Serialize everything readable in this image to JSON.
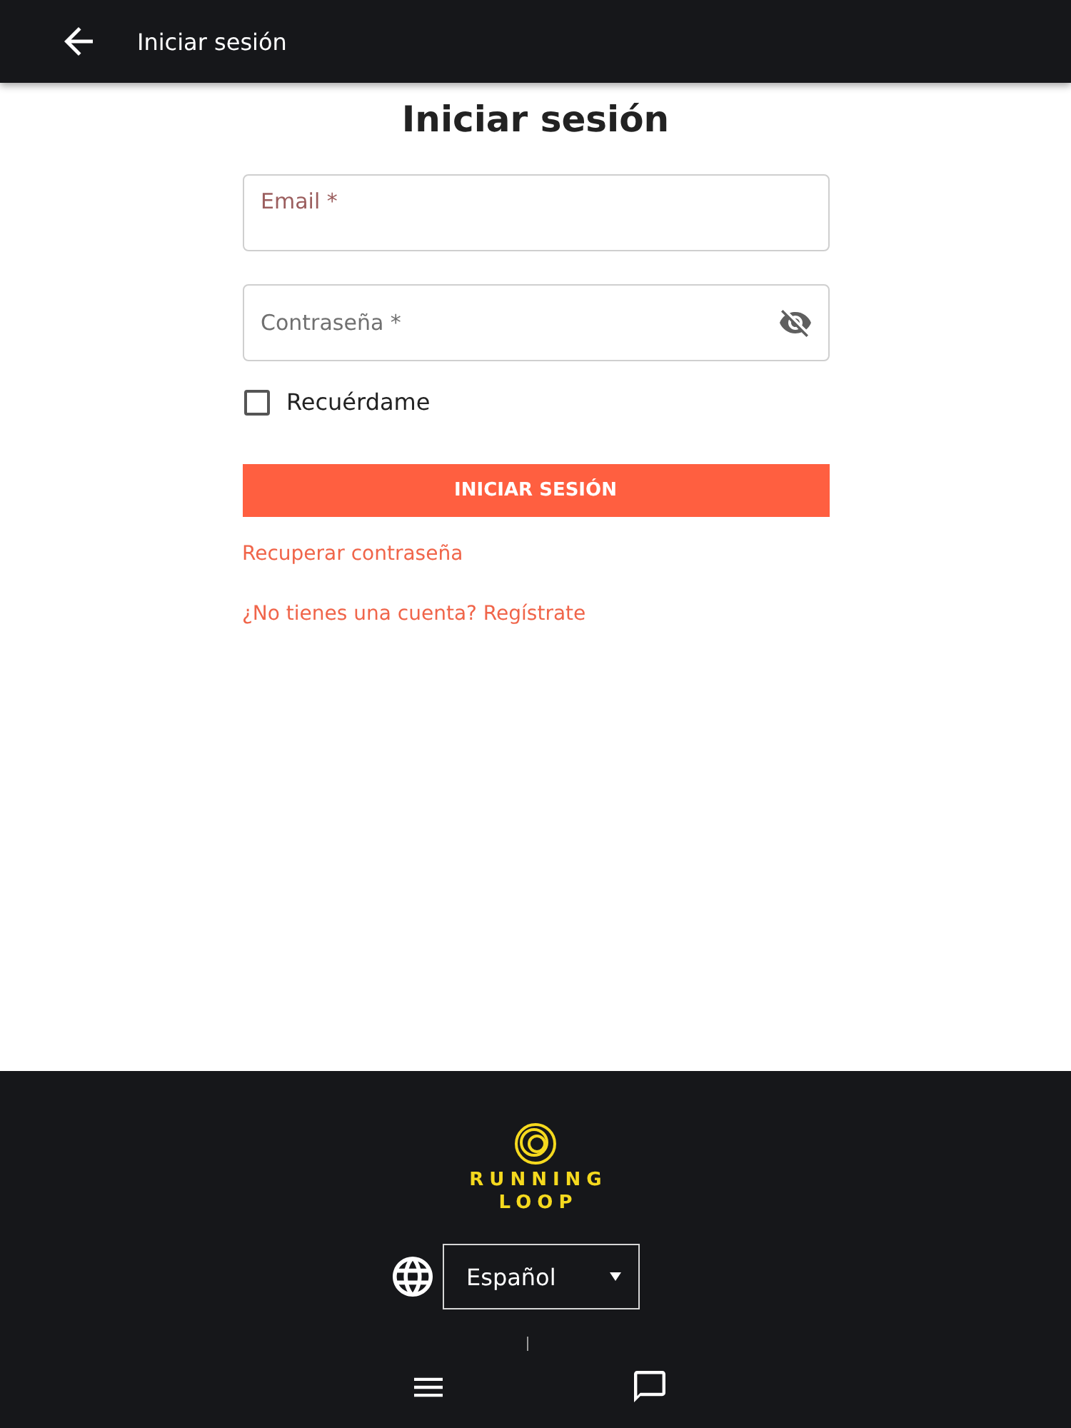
{
  "app_bar": {
    "title": "Iniciar sesión"
  },
  "login": {
    "heading": "Iniciar sesión",
    "email": {
      "label": "Email *",
      "focused": true
    },
    "password": {
      "label": "Contraseña *",
      "focused": false,
      "visible": false
    },
    "remember": {
      "label": "Recuérdame",
      "checked": false
    },
    "submit": "INICIAR SESIÓN",
    "links": [
      "Recuperar contraseña",
      "¿No tienes una cuenta? Regístrate"
    ]
  },
  "footer": {
    "logo_lines": [
      "RUNNING",
      "LOOP"
    ],
    "language": {
      "value": "Español"
    }
  }
}
